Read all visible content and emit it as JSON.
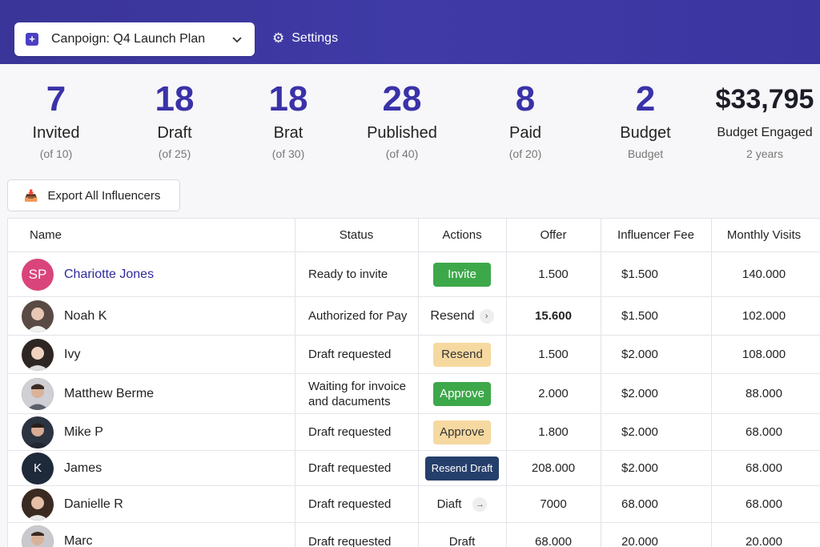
{
  "header": {
    "campaign_label": "Canpoign: Q4 Launch Plan",
    "settings_label": "Settings"
  },
  "stats": [
    {
      "value": "7",
      "label": "Invited",
      "sub": "(of 10)"
    },
    {
      "value": "18",
      "label": "Draft",
      "sub": "(of 25)"
    },
    {
      "value": "18",
      "label": "Brat",
      "sub": "(of 30)"
    },
    {
      "value": "28",
      "label": "Published",
      "sub": "(of 40)"
    },
    {
      "value": "8",
      "label": "Paid",
      "sub": "(of 20)"
    },
    {
      "value": "2",
      "label": "Budget",
      "sub": "Budget"
    },
    {
      "value": "$33,795",
      "label": "Budget Engaged",
      "sub": "2 years"
    }
  ],
  "export_label": "Export All Influencers",
  "table": {
    "columns": [
      "Name",
      "Status",
      "Actions",
      "Offer",
      "Influencer Fee",
      "Monthly Visits"
    ],
    "rows": [
      {
        "initials": "SP",
        "name": "Chariotte Jones",
        "status": "Ready to invite",
        "action": "Invite",
        "offer": "1.500",
        "fee": "$1.500",
        "visits": "140.000"
      },
      {
        "initials": "",
        "name": "Noah K",
        "status": "Authorized for Pay",
        "action": "Resend",
        "offer": "15.600",
        "fee": "$1.500",
        "visits": "102.000"
      },
      {
        "initials": "",
        "name": "Ivy",
        "status": "Draft requested",
        "action": "Resend",
        "offer": "1.500",
        "fee": "$2.000",
        "visits": "108.000"
      },
      {
        "initials": "",
        "name": "Matthew Berme",
        "status": "Waiting for invoice and dacuments",
        "action": "Approve",
        "offer": "2.000",
        "fee": "$2.000",
        "visits": "88.000"
      },
      {
        "initials": "",
        "name": "Mike P",
        "status": "Draft requested",
        "action": "Approve",
        "offer": "1.800",
        "fee": "$2.000",
        "visits": "68.000"
      },
      {
        "initials": "K",
        "name": "James",
        "status": "Draft requested",
        "action": "Resend Draft",
        "offer": "208.000",
        "fee": "$2.000",
        "visits": "68.000"
      },
      {
        "initials": "",
        "name": "Danielle R",
        "status": "Draft requested",
        "action": "Diaft",
        "offer": "7000",
        "fee": "68.000",
        "visits": "68.000"
      },
      {
        "initials": "",
        "name": "Marc",
        "status": "Draft requested",
        "action": "Draft",
        "offer": "68.000",
        "fee": "20.000",
        "visits": "20.000"
      }
    ]
  }
}
